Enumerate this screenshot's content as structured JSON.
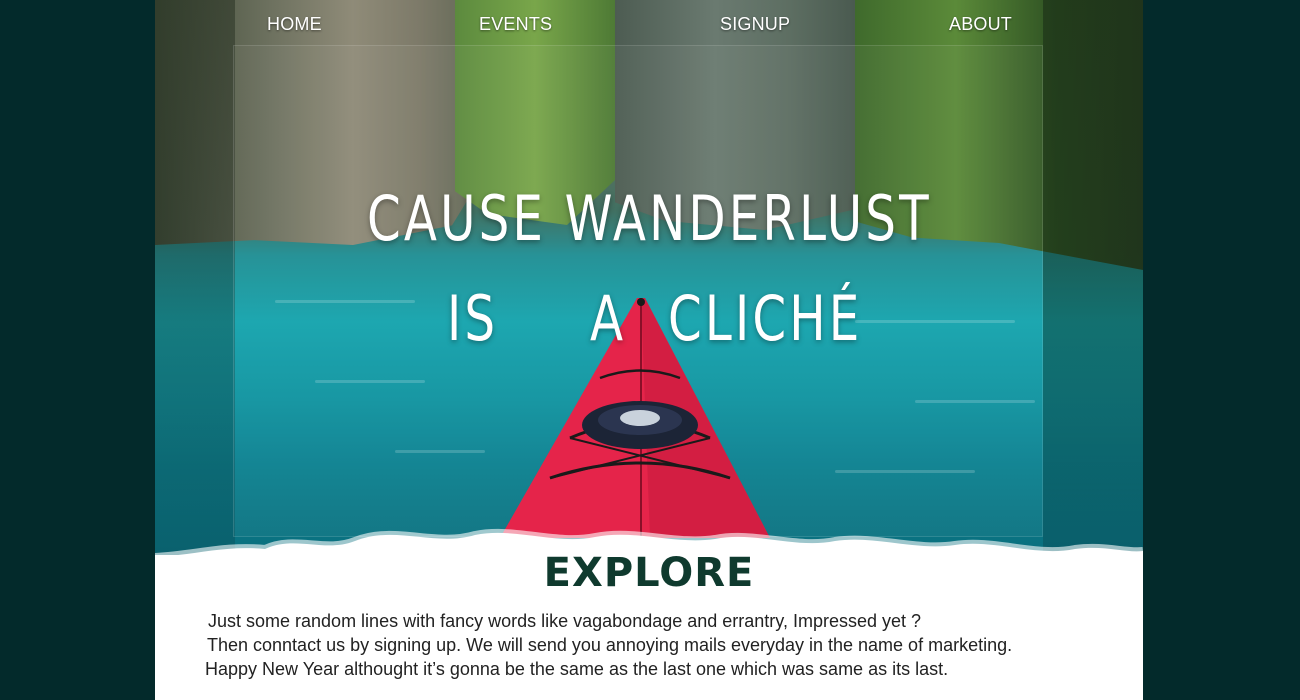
{
  "nav": {
    "items": [
      {
        "label": "HOME"
      },
      {
        "label": "EVENTS"
      },
      {
        "label": "SIGNUP"
      },
      {
        "label": "ABOUT"
      }
    ]
  },
  "hero": {
    "headline_line1": "CAUSE WANDERLUST",
    "headline_line2_a": "IS",
    "headline_line2_b": "A",
    "headline_line2_c": "CLICHÉ",
    "image_subject": "red kayak on turquoise lagoon between limestone cliffs"
  },
  "explore": {
    "title": "EXPLORE",
    "lines": [
      "Just some random lines with fancy words like vagabondage and errantry, Impressed yet ?",
      "Then conntact us by signing up. We will send you annoying mails everyday in the name of  marketing.",
      "Happy New Year althought it’s gonna be the same as the last one which was same as its last."
    ]
  },
  "colors": {
    "outer_background": "#032a2b",
    "kayak": "#e5244a",
    "title_text": "#0f3a2e",
    "water": "#14a4ad"
  }
}
